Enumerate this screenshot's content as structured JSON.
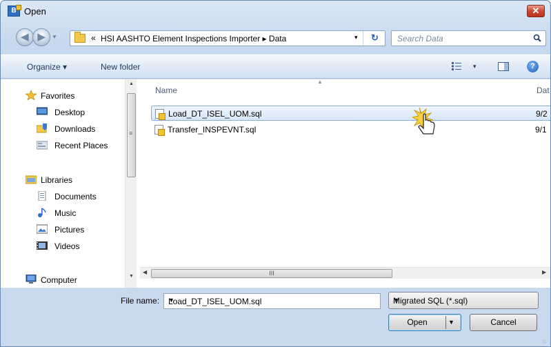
{
  "window": {
    "title": "Open",
    "app_icon_text": "B",
    "close_label": "✕"
  },
  "nav": {
    "back_label": "◀",
    "forward_label": "▶"
  },
  "address": {
    "chevron": "«",
    "path": "HSI AASHTO Element Inspections Importer ▸ Data",
    "dropdown": "▾",
    "refresh": "↻"
  },
  "search": {
    "placeholder": "Search Data"
  },
  "toolbar": {
    "organize": "Organize ▾",
    "new_folder": "New folder",
    "view_dropdown": "▾",
    "help": "?"
  },
  "sidebar": {
    "items": [
      {
        "label": "Favorites",
        "icon": "star-icon",
        "level": 0
      },
      {
        "label": "Desktop",
        "icon": "desktop-icon",
        "level": 1
      },
      {
        "label": "Downloads",
        "icon": "downloads-icon",
        "level": 1
      },
      {
        "label": "Recent Places",
        "icon": "recent-places-icon",
        "level": 1
      },
      {
        "label": "Libraries",
        "icon": "libraries-icon",
        "level": 0
      },
      {
        "label": "Documents",
        "icon": "documents-icon",
        "level": 1
      },
      {
        "label": "Music",
        "icon": "music-icon",
        "level": 1
      },
      {
        "label": "Pictures",
        "icon": "pictures-icon",
        "level": 1
      },
      {
        "label": "Videos",
        "icon": "videos-icon",
        "level": 1
      },
      {
        "label": "Computer",
        "icon": "computer-icon",
        "level": 0
      }
    ]
  },
  "files": {
    "columns": {
      "name": "Name",
      "date": "Dat"
    },
    "rows": [
      {
        "name": "Load_DT_ISEL_UOM.sql",
        "date": "9/2",
        "selected": true
      },
      {
        "name": "Transfer_INSPEVNT.sql",
        "date": "9/1",
        "selected": false
      }
    ]
  },
  "scrollbar": {
    "thumb_grip": "III"
  },
  "footer": {
    "file_name_label": "File name:",
    "file_name_value": "Load_DT_ISEL_UOM.sql",
    "file_type": "Migrated SQL (*.sql)",
    "open_label": "Open",
    "cancel_label": "Cancel"
  },
  "colors": {
    "selection_border": "#84acdd",
    "title_bar": "#dbe8f5",
    "close": "#c94a33"
  }
}
